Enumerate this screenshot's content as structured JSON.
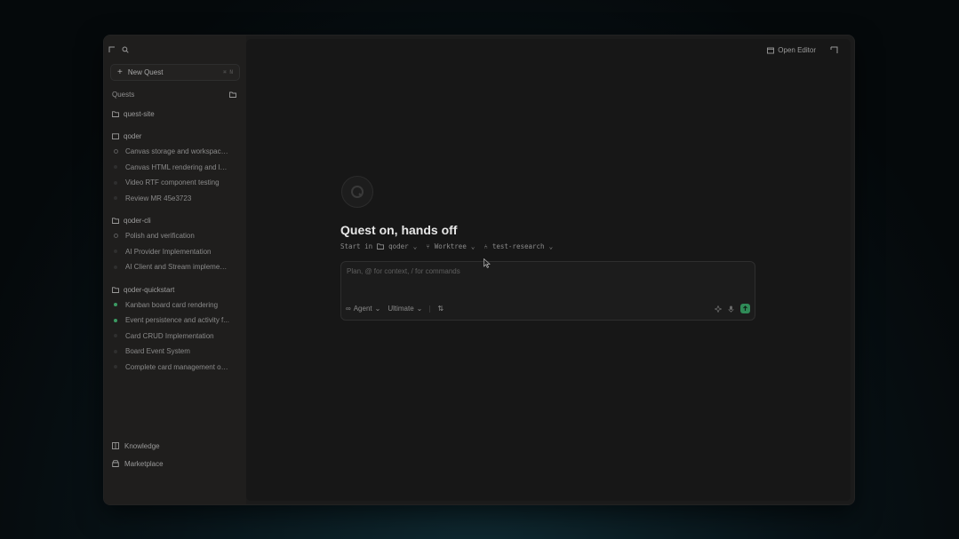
{
  "sidebar": {
    "new_quest": {
      "label": "New Quest",
      "shortcut": "⌘ N"
    },
    "section_title": "Quests",
    "groups": [
      {
        "name": "quest-site",
        "items": []
      },
      {
        "name": "qoder",
        "items": [
          {
            "label": "Canvas storage and workspace ...",
            "status": "ring"
          },
          {
            "label": "Canvas HTML rendering and layout...",
            "status": "idle"
          },
          {
            "label": "Video RTF component testing",
            "status": "idle"
          },
          {
            "label": "Review MR 45e3723",
            "status": "idle"
          }
        ]
      },
      {
        "name": "qoder-cli",
        "items": [
          {
            "label": "Polish and verification",
            "status": "ring"
          },
          {
            "label": "AI Provider Implementation",
            "status": "idle"
          },
          {
            "label": "AI Client and Stream implement...",
            "status": "idle"
          }
        ]
      },
      {
        "name": "qoder-quickstart",
        "items": [
          {
            "label": "Kanban board card rendering",
            "status": "green"
          },
          {
            "label": "Event persistence and activity f...",
            "status": "green"
          },
          {
            "label": "Card CRUD Implementation",
            "status": "idle"
          },
          {
            "label": "Board Event System",
            "status": "idle"
          },
          {
            "label": "Complete card management op...",
            "status": "idle"
          }
        ]
      }
    ],
    "bottom": [
      {
        "label": "Knowledge",
        "icon": "book-icon"
      },
      {
        "label": "Marketplace",
        "icon": "store-icon"
      }
    ]
  },
  "main": {
    "open_editor": "Open Editor",
    "title": "Quest on, hands off",
    "start_in": "Start in",
    "project": "qoder",
    "worktree": "Worktree",
    "branch": "test-research",
    "composer": {
      "placeholder": "Plan, @ for context, / for commands",
      "mode": "Agent",
      "model": "Ultimate",
      "extra": "⇅"
    }
  },
  "colors": {
    "accent": "#2f8a57",
    "background": "#171717",
    "sidebar": "#1f1e1d"
  }
}
